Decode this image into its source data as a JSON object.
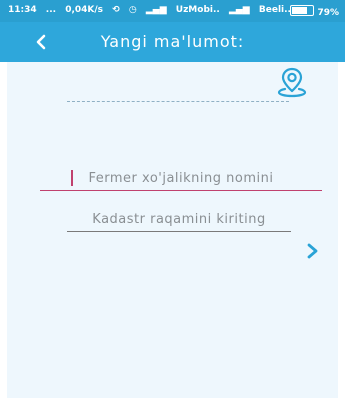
{
  "status_bar": {
    "time": "11:34",
    "dots": "...",
    "speed": "0,04K/s",
    "carrier1": "UzMobi..",
    "carrier2": "Beeli..",
    "battery": "79%",
    "battery_level": 0.79
  },
  "toolbar": {
    "title": "Yangi ma'lumot:",
    "back_icon": "chevron-left-icon",
    "color": "#2ea7db"
  },
  "location": {
    "icon": "map-pin-icon",
    "color": "#2aa3d6"
  },
  "form": {
    "farm_name_placeholder": "Fermer xo'jalikning nomini",
    "farm_name_value": "",
    "kadastr_placeholder": "Kadastr raqamini kiriting",
    "kadastr_value": "",
    "focus_color": "#c0416e"
  },
  "next": {
    "icon": "chevron-right-icon",
    "color": "#2aa3d6"
  }
}
